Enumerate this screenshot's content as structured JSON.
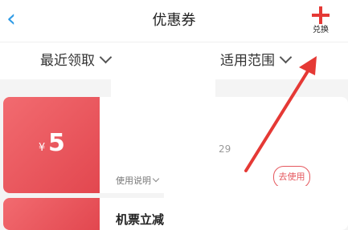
{
  "header": {
    "back_icon": "chevron-left-icon",
    "title": "优惠券",
    "exchange_label": "兑换",
    "exchange_icon": "plus-icon",
    "accent": "#e53935"
  },
  "filters": [
    {
      "label": "最近领取"
    },
    {
      "label": "适用范围"
    }
  ],
  "coupons": [
    {
      "currency": "¥",
      "amount": "5",
      "date_fragment": "29",
      "rule_label": "使用说明",
      "action_label": "去使用"
    },
    {
      "title_fragment": "机票立减"
    }
  ],
  "annotation": {
    "color": "#e53935"
  }
}
